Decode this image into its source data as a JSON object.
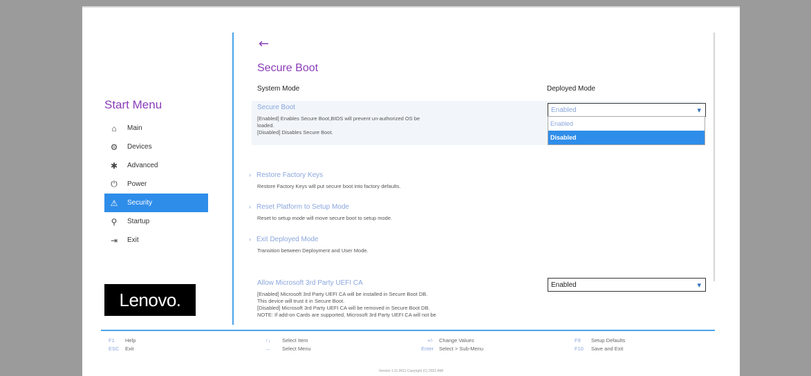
{
  "sidebar": {
    "title": "Start Menu",
    "items": [
      {
        "label": "Main",
        "icon": "⌂"
      },
      {
        "label": "Devices",
        "icon": "⚙"
      },
      {
        "label": "Advanced",
        "icon": "✱"
      },
      {
        "label": "Power",
        "icon": "⏻"
      },
      {
        "label": "Security",
        "icon": "⚠"
      },
      {
        "label": "Startup",
        "icon": "⚲"
      },
      {
        "label": "Exit",
        "icon": "⇥"
      }
    ],
    "logo": "Lenovo."
  },
  "main": {
    "back_icon": "←",
    "title": "Secure Boot",
    "system_mode_label": "System Mode",
    "system_mode_value": "Deployed Mode",
    "secure_boot": {
      "title": "Secure Boot",
      "desc_line1": "[Enabled] Enables Secure Boot,BIOS will prevent un-authorized OS be",
      "desc_line2": "loaded.",
      "desc_line3": "[Disabled] Disables Secure Boot.",
      "value": "Enabled",
      "options": [
        "Enabled",
        "Disabled"
      ]
    },
    "restore_keys": {
      "title": "Restore Factory Keys",
      "desc": "Restore Factory Keys will put secure boot into factory defaults."
    },
    "reset_platform": {
      "title": "Reset Platform to Setup Mode",
      "desc": "Reset to setup mode will move secure boot to setup mode."
    },
    "exit_deployed": {
      "title": "Exit Deployed Mode",
      "desc": "Transition between Deployment and User Mode."
    },
    "ms_uefi": {
      "title": "Allow Microsoft 3rd Party UEFI CA",
      "desc_line1": "[Enabled] Microsoft 3rd Party UEFI CA will be installed in Secure Boot DB.",
      "desc_line2": "This device will trust it in Secure Boot.",
      "desc_line3": "[Disabled] Microsoft 3rd Party UEFI CA will be removed in Secure Boot DB.",
      "desc_line4": "NOTE: If add-on Cards are supported, Microsoft 3rd Party UEFI CA will not be",
      "value": "Enabled"
    }
  },
  "footer": {
    "col1": [
      {
        "key": "F1",
        "label": "Help"
      },
      {
        "key": "ESC",
        "label": "Exit"
      }
    ],
    "col2": [
      {
        "key": "↑↓",
        "label": "Select Item"
      },
      {
        "key": "↔",
        "label": "Select Menu"
      }
    ],
    "col3": [
      {
        "key": "+/-",
        "label": "Change Values"
      },
      {
        "key": "Enter",
        "label": "Select > Sub-Menu"
      }
    ],
    "col4": [
      {
        "key": "F9",
        "label": "Setup Defaults"
      },
      {
        "key": "F10",
        "label": "Save and Exit"
      }
    ]
  },
  "version": "Version 1.11.0011 Copyright (C) 2022 AMI"
}
